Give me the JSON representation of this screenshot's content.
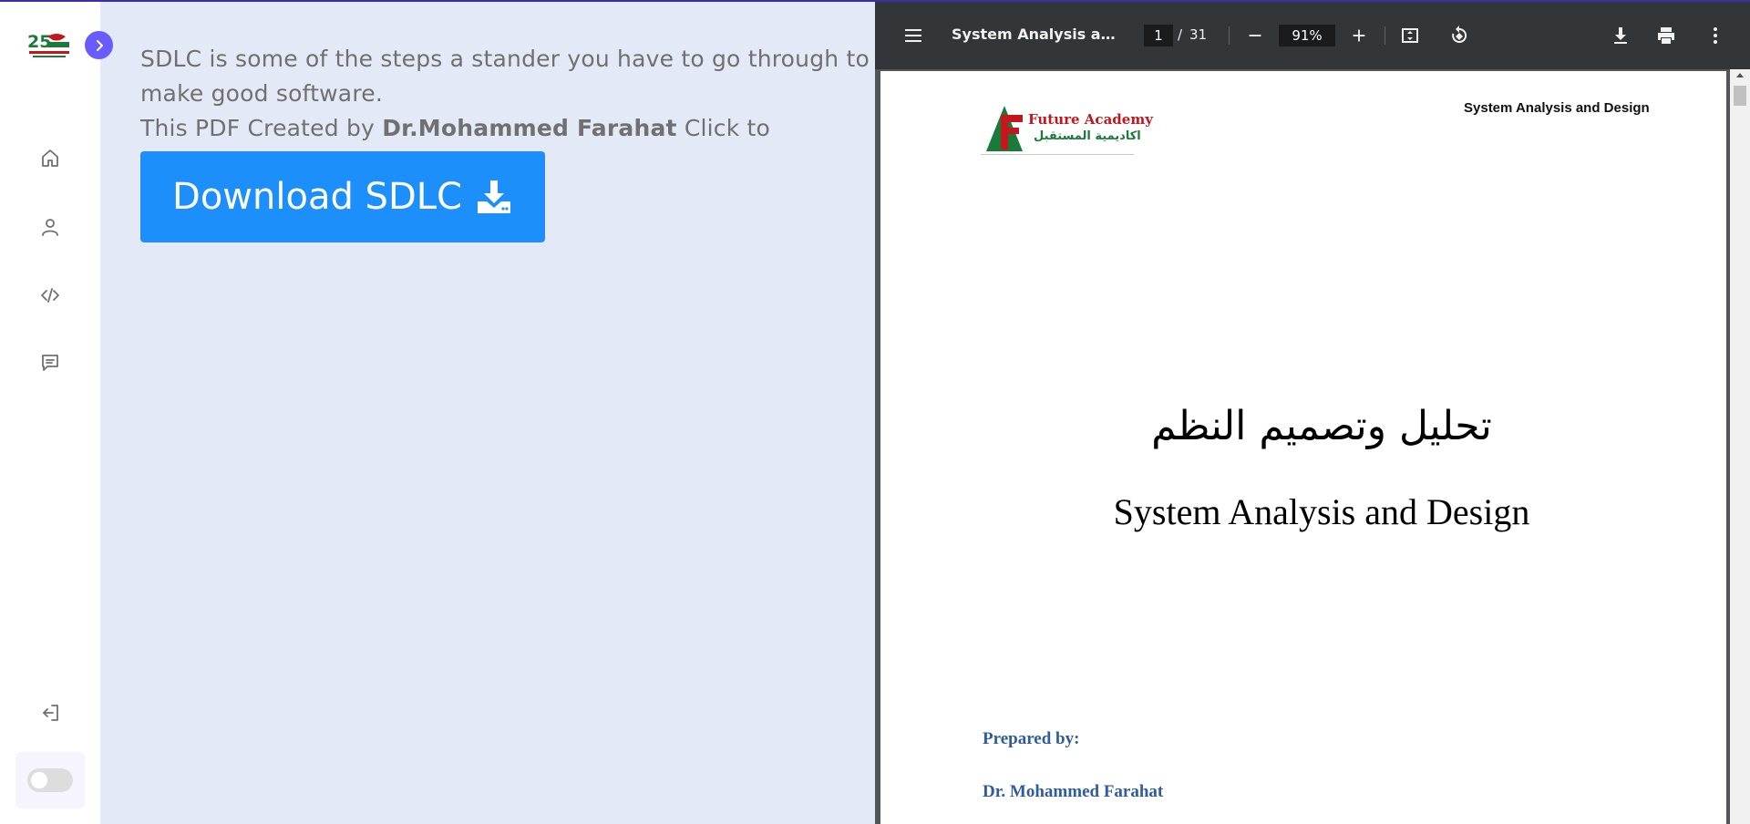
{
  "sidebar": {
    "logo_label": "25",
    "nav": [
      {
        "icon": "home-icon"
      },
      {
        "icon": "user-icon"
      },
      {
        "icon": "code-icon"
      },
      {
        "icon": "message-icon"
      }
    ],
    "logout_icon": "logout-icon",
    "mode": "light"
  },
  "main": {
    "intro_line": "SDLC is some of the steps a stander you have to go through to make good software.",
    "created_prefix": "This PDF Created by ",
    "author": "Dr.Mohammed Farahat",
    "created_suffix": " Click to Download.",
    "download_label": "Download SDLC"
  },
  "pdf": {
    "title": "System Analysis and Design",
    "page_current": "1",
    "page_separator": "/",
    "page_total": "31",
    "zoom": "91%",
    "page": {
      "logo_en": "Future Academy",
      "logo_ar": "اكاديمية المستقبل",
      "header": "System Analysis and Design",
      "title_ar": "تحليل وتصميم النظم",
      "title_en": "System Analysis and Design",
      "prepared_by": "Prepared by:",
      "author": "Dr. Mohammed Farahat"
    }
  },
  "colors": {
    "accent": "#695cfe",
    "download_button": "#1d8ffb",
    "body_bg": "#e4e9f7",
    "toolbar_bg": "#323639",
    "pdf_blue": "#2e5c9e"
  }
}
